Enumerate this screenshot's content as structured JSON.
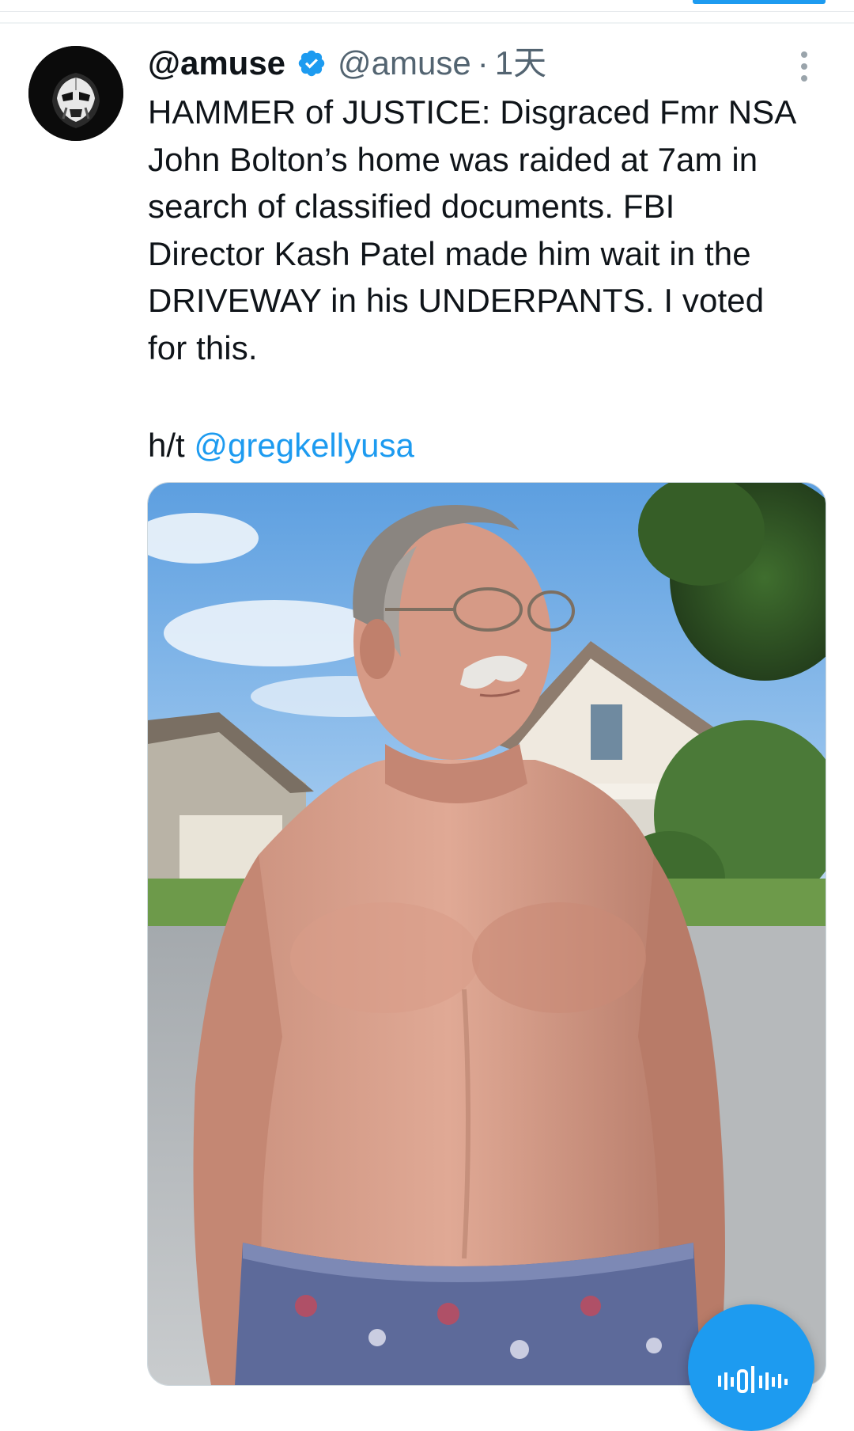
{
  "tweet": {
    "author": {
      "display_name": "@amuse",
      "handle": "@amuse",
      "verified": true,
      "avatar_icon": "stormtrooper-avatar-icon"
    },
    "separator": "·",
    "timestamp": "1天",
    "text": "HAMMER of JUSTICE: Disgraced Fmr NSA\nJohn Bolton’s home was raided at 7am in\nsearch of classified documents. FBI\nDirector Kash Patel made him wait in the\nDRIVEWAY in his UNDERPANTS. I voted\nfor this.",
    "hat_tip_prefix": "h/t ",
    "hat_tip_mention": "@gregkellyusa",
    "media_kind": "photo"
  },
  "icons": {
    "verified": "verified-badge-icon",
    "more": "more-vertical-icon",
    "voice": "voice-wave-icon"
  },
  "colors": {
    "link": "#1d9bf0",
    "secondary_text": "#536471",
    "verified": "#1d9bf0",
    "fab": "#1d9bf0"
  }
}
